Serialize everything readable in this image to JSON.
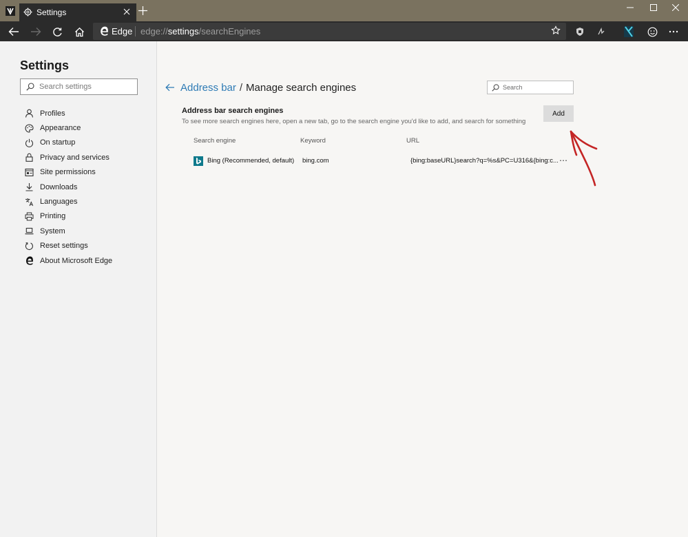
{
  "browser": {
    "tab_title": "Settings",
    "site_label": "Edge",
    "url_prefix": "edge://",
    "url_bold": "settings",
    "url_suffix": "/searchEngines",
    "accent": "#7a725f"
  },
  "sidebar": {
    "title": "Settings",
    "search_placeholder": "Search settings",
    "items": [
      {
        "label": "Profiles",
        "icon": "person-icon"
      },
      {
        "label": "Appearance",
        "icon": "palette-icon"
      },
      {
        "label": "On startup",
        "icon": "power-icon"
      },
      {
        "label": "Privacy and services",
        "icon": "lock-icon"
      },
      {
        "label": "Site permissions",
        "icon": "permissions-icon"
      },
      {
        "label": "Downloads",
        "icon": "download-icon"
      },
      {
        "label": "Languages",
        "icon": "languages-icon"
      },
      {
        "label": "Printing",
        "icon": "printer-icon"
      },
      {
        "label": "System",
        "icon": "laptop-icon"
      },
      {
        "label": "Reset settings",
        "icon": "reset-icon"
      },
      {
        "label": "About Microsoft Edge",
        "icon": "edge-icon"
      }
    ]
  },
  "main": {
    "breadcrumb_parent": "Address bar",
    "breadcrumb_sep": "/",
    "breadcrumb_current": "Manage search engines",
    "search_placeholder": "Search",
    "section_title": "Address bar search engines",
    "section_desc": "To see more search engines here, open a new tab, go to the search engine you'd like to add, and search for something",
    "add_label": "Add",
    "columns": [
      "Search engine",
      "Keyword",
      "URL"
    ],
    "engines": [
      {
        "name": "Bing (Recommended, default)",
        "keyword": "bing.com",
        "url": "{bing:baseURL}search?q=%s&PC=U316&{bing:c...",
        "more": "⋯"
      }
    ]
  }
}
